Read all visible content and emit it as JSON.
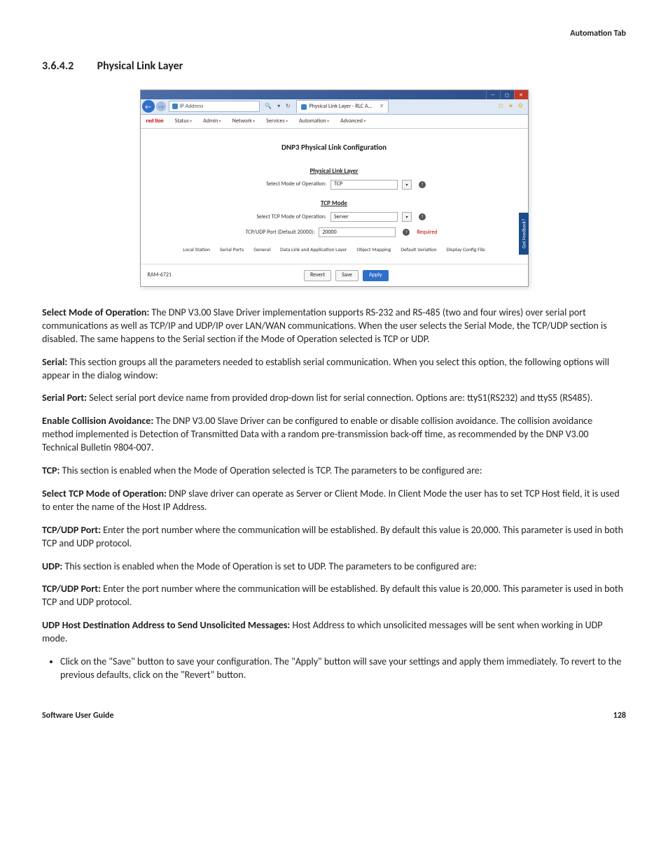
{
  "header": {
    "tab_label": "Automation Tab"
  },
  "section": {
    "number": "3.6.4.2",
    "title": "Physical Link Layer"
  },
  "screenshot": {
    "address_bar": "IP Address",
    "tab_title": "Physical Link Layer - RLC A...",
    "brand": "red lion",
    "menus": [
      "Status",
      "Admin",
      "Network",
      "Services",
      "Automation",
      "Advanced"
    ],
    "config_title": "DNP3 Physical Link Configuration",
    "pll": {
      "heading": "Physical Link Layer",
      "mode_label": "Select Mode of Operation",
      "mode_value": "TCP"
    },
    "tcp": {
      "heading": "TCP Mode",
      "tcp_mode_label": "Select TCP Mode of Operation",
      "tcp_mode_value": "Server",
      "port_label": "TCP/UDP Port (Default 20000)",
      "port_value": "20000",
      "required": "Required"
    },
    "feedback": "Got Feedback?",
    "bottom_tabs": [
      "Local Station",
      "Serial Ports",
      "General",
      "Data Link and Application Layer",
      "Object Mapping",
      "Default Variation",
      "Display Config File"
    ],
    "model": "RAM-6721",
    "buttons": {
      "revert": "Revert",
      "save": "Save",
      "apply": "Apply"
    }
  },
  "body": {
    "p1a": "Select Mode of Operation: ",
    "p1b": "The DNP V3.00 Slave Driver implementation supports RS-232 and RS-485 (two and four wires) over serial port communications as well as TCP/IP and UDP/IP over LAN/WAN communications. When the user selects the Serial Mode, the TCP/UDP section is disabled. The same happens to the Serial section if the Mode of Operation selected is TCP or UDP.",
    "p2a": "Serial: ",
    "p2b": "This section groups all the parameters needed to establish serial communication. When you select this option, the following options will appear in the dialog window:",
    "p3a": "Serial Port: ",
    "p3b": "Select serial port device name from provided drop-down list for serial connection. Options are: ttyS1(RS232) and ttyS5 (RS485).",
    "p4a": "Enable Collision Avoidance: ",
    "p4b": "The DNP V3.00 Slave Driver can be configured to enable or disable collision avoidance. The collision avoidance method implemented is Detection of Transmitted Data with a random pre-transmission back-off time, as recommended by the DNP V3.00 Technical Bulletin 9804-007.",
    "p5a": "TCP: ",
    "p5b": "This section is enabled when the Mode of Operation selected is TCP. The parameters to be configured are:",
    "p6a": "Select TCP Mode of Operation: ",
    "p6b": "DNP slave driver can operate as Server or Client Mode. In Client Mode the user has to set TCP Host field, it is used to enter the name of the Host IP Address.",
    "p7a": "TCP/UDP Port: ",
    "p7b": "Enter the port number where the communication will be established. By default this value is 20,000. This parameter is used in both TCP and UDP protocol.",
    "p8a": "UDP: ",
    "p8b": "This section is enabled when the Mode of Operation is set to UDP. The parameters to be configured are:",
    "p9a": "TCP/UDP Port: ",
    "p9b": "Enter the port number where the communication will be established. By default this value is 20,000. This parameter is used in both TCP and UDP protocol.",
    "p10a": "UDP Host Destination Address to Send Unsolicited Messages: ",
    "p10b": "Host Address to which unsolicited messages will be sent when working in UDP mode.",
    "bullet1": "Click on the \"Save\" button to save your configuration. The \"Apply\" button will save your settings and apply them immediately. To revert to the previous defaults, click on the \"Revert\" button."
  },
  "footer": {
    "left": "Software User Guide",
    "right": "128"
  }
}
